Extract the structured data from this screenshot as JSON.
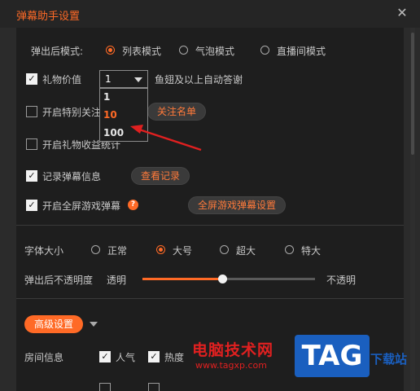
{
  "window": {
    "title": "弹幕助手设置",
    "close_glyph": "✕"
  },
  "popup_mode": {
    "label": "弹出后模式:",
    "options": [
      "列表模式",
      "气泡模式",
      "直播间模式"
    ],
    "selected": "列表模式"
  },
  "gift_value": {
    "label": "礼物价值",
    "checked": true,
    "select_value": "1",
    "options": [
      "1",
      "10",
      "100"
    ],
    "highlighted_option": "10",
    "suffix": "鱼翅及以上自动答谢"
  },
  "special_follow": {
    "label": "开启特别关注",
    "checked": false,
    "button": "关注名单"
  },
  "gift_income": {
    "label": "开启礼物收益统计",
    "checked": false
  },
  "record_danmaku": {
    "label": "记录弹幕信息",
    "checked": true,
    "button": "查看记录"
  },
  "fullscreen_game": {
    "label": "开启全屏游戏弹幕",
    "checked": true,
    "help_glyph": "?",
    "button": "全屏游戏弹幕设置"
  },
  "font_size": {
    "label": "字体大小",
    "options": [
      "正常",
      "大号",
      "超大",
      "特大"
    ],
    "selected": "大号"
  },
  "opacity": {
    "label": "弹出后不透明度",
    "min_label": "透明",
    "max_label": "不透明",
    "value_fraction": 0.46
  },
  "advanced": {
    "label": "高级设置"
  },
  "room_info": {
    "label": "房间信息",
    "items": [
      {
        "label": "人气",
        "checked": true
      },
      {
        "label": "热度",
        "checked": true
      }
    ]
  },
  "watermark": {
    "site": "电脑技术网",
    "url": "www.tagxp.com",
    "logo": "TAG",
    "download": "下载站"
  },
  "colors": {
    "accent": "#ff6a26",
    "background": "#1e1e1e",
    "arrow": "#e02020"
  }
}
